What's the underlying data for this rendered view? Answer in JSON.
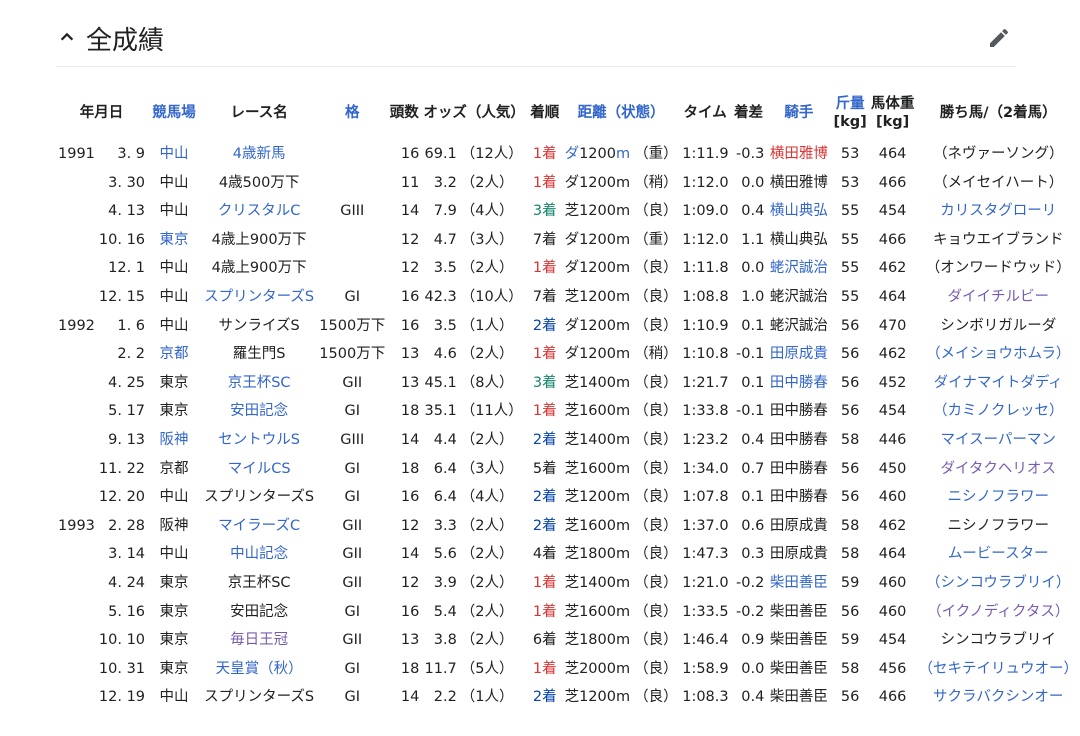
{
  "section": {
    "title": "全成績"
  },
  "headers": {
    "date": "年月日",
    "track": "競馬場",
    "race": "レース名",
    "grade": "格",
    "field": "頭数",
    "odds": "オッズ（人気）",
    "finish": "着順",
    "distance": "距離",
    "condition": "（状態）",
    "time": "タイム",
    "margin": "着差",
    "jockey": "騎手",
    "weight": "斤量",
    "weight_unit": "[kg]",
    "body": "馬体重",
    "body_unit": "[kg]",
    "winner": "勝ち馬/（2着馬）"
  },
  "rows": [
    {
      "year": "1991",
      "date": "3. 9",
      "track": "中山",
      "track_link": true,
      "race": "4歳新馬",
      "race_style": "link",
      "grade": "",
      "field": "16",
      "odds": "69.1",
      "pop": "（12人）",
      "finish": "1着",
      "finish_style": "red",
      "surface": "ダ",
      "dist": "1200",
      "dist_link": true,
      "unit": "m",
      "cond": "（重）",
      "time": "1:11.9",
      "margin": "-0.3",
      "jockey": "横田雅博",
      "jockey_style": "red",
      "weight": "53",
      "body": "464",
      "winner": "（ネヴァーソング）",
      "winner_style": ""
    },
    {
      "year": "",
      "date": "3. 30",
      "track": "中山",
      "track_link": false,
      "race": "4歳500万下",
      "race_style": "",
      "grade": "",
      "field": "11",
      "odds": "3.2",
      "pop": "（2人）",
      "finish": "1着",
      "finish_style": "red",
      "surface": "ダ",
      "dist": "1200",
      "dist_link": false,
      "unit": "m",
      "cond": "（稍）",
      "time": "1:12.0",
      "margin": "0.0",
      "jockey": "横田雅博",
      "jockey_style": "",
      "weight": "53",
      "body": "466",
      "winner": "（メイセイハート）",
      "winner_style": ""
    },
    {
      "year": "",
      "date": "4. 13",
      "track": "中山",
      "track_link": false,
      "race": "クリスタルC",
      "race_style": "link",
      "grade": "GIII",
      "field": "14",
      "odds": "7.9",
      "pop": "（4人）",
      "finish": "3着",
      "finish_style": "green",
      "surface": "芝",
      "dist": "1200",
      "dist_link": false,
      "unit": "m",
      "cond": "（良）",
      "time": "1:09.0",
      "margin": "0.4",
      "jockey": "横山典弘",
      "jockey_style": "link",
      "weight": "55",
      "body": "454",
      "winner": "カリスタグローリ",
      "winner_style": "link"
    },
    {
      "year": "",
      "date": "10. 16",
      "track": "東京",
      "track_link": true,
      "race": "4歳上900万下",
      "race_style": "",
      "grade": "",
      "field": "12",
      "odds": "4.7",
      "pop": "（3人）",
      "finish": "7着",
      "finish_style": "",
      "surface": "ダ",
      "dist": "1200",
      "dist_link": false,
      "unit": "m",
      "cond": "（重）",
      "time": "1:12.0",
      "margin": "1.1",
      "jockey": "横山典弘",
      "jockey_style": "",
      "weight": "55",
      "body": "466",
      "winner": "キョウエイブランド",
      "winner_style": ""
    },
    {
      "year": "",
      "date": "12. 1",
      "track": "中山",
      "track_link": false,
      "race": "4歳上900万下",
      "race_style": "",
      "grade": "",
      "field": "12",
      "odds": "3.5",
      "pop": "（2人）",
      "finish": "1着",
      "finish_style": "red",
      "surface": "ダ",
      "dist": "1200",
      "dist_link": false,
      "unit": "m",
      "cond": "（良）",
      "time": "1:11.8",
      "margin": "0.0",
      "jockey": "蛯沢誠治",
      "jockey_style": "link",
      "weight": "55",
      "body": "462",
      "winner": "（オンワードウッド）",
      "winner_style": ""
    },
    {
      "year": "",
      "date": "12. 15",
      "track": "中山",
      "track_link": false,
      "race": "スプリンターズS",
      "race_style": "link",
      "grade": "GI",
      "field": "16",
      "odds": "42.3",
      "pop": "（10人）",
      "finish": "7着",
      "finish_style": "",
      "surface": "芝",
      "dist": "1200",
      "dist_link": false,
      "unit": "m",
      "cond": "（良）",
      "time": "1:08.8",
      "margin": "1.0",
      "jockey": "蛯沢誠治",
      "jockey_style": "",
      "weight": "55",
      "body": "464",
      "winner": "ダイイチルビー",
      "winner_style": "visited"
    },
    {
      "year": "1992",
      "date": "1. 6",
      "track": "中山",
      "track_link": false,
      "race": "サンライズS",
      "race_style": "",
      "grade": "1500万下",
      "field": "16",
      "odds": "3.5",
      "pop": "（1人）",
      "finish": "2着",
      "finish_style": "blue",
      "surface": "ダ",
      "dist": "1200",
      "dist_link": false,
      "unit": "m",
      "cond": "（良）",
      "time": "1:10.9",
      "margin": "0.1",
      "jockey": "蛯沢誠治",
      "jockey_style": "",
      "weight": "56",
      "body": "470",
      "winner": "シンボリガルーダ",
      "winner_style": ""
    },
    {
      "year": "",
      "date": "2. 2",
      "track": "京都",
      "track_link": true,
      "race": "羅生門S",
      "race_style": "",
      "grade": "1500万下",
      "field": "13",
      "odds": "4.6",
      "pop": "（2人）",
      "finish": "1着",
      "finish_style": "red",
      "surface": "ダ",
      "dist": "1200",
      "dist_link": false,
      "unit": "m",
      "cond": "（稍）",
      "time": "1:10.8",
      "margin": "-0.1",
      "jockey": "田原成貴",
      "jockey_style": "link",
      "weight": "56",
      "body": "462",
      "winner": "（メイショウホムラ）",
      "winner_style": "link"
    },
    {
      "year": "",
      "date": "4. 25",
      "track": "東京",
      "track_link": false,
      "race": "京王杯SC",
      "race_style": "link",
      "grade": "GII",
      "field": "13",
      "odds": "45.1",
      "pop": "（8人）",
      "finish": "3着",
      "finish_style": "green",
      "surface": "芝",
      "dist": "1400",
      "dist_link": false,
      "unit": "m",
      "cond": "（良）",
      "time": "1:21.7",
      "margin": "0.1",
      "jockey": "田中勝春",
      "jockey_style": "link",
      "weight": "56",
      "body": "452",
      "winner": "ダイナマイトダディ",
      "winner_style": "link"
    },
    {
      "year": "",
      "date": "5. 17",
      "track": "東京",
      "track_link": false,
      "race": "安田記念",
      "race_style": "link",
      "grade": "GI",
      "field": "18",
      "odds": "35.1",
      "pop": "（11人）",
      "finish": "1着",
      "finish_style": "red",
      "surface": "芝",
      "dist": "1600",
      "dist_link": false,
      "unit": "m",
      "cond": "（良）",
      "time": "1:33.8",
      "margin": "-0.1",
      "jockey": "田中勝春",
      "jockey_style": "",
      "weight": "56",
      "body": "454",
      "winner": "（カミノクレッセ）",
      "winner_style": "link"
    },
    {
      "year": "",
      "date": "9. 13",
      "track": "阪神",
      "track_link": true,
      "race": "セントウルS",
      "race_style": "link",
      "grade": "GIII",
      "field": "14",
      "odds": "4.4",
      "pop": "（2人）",
      "finish": "2着",
      "finish_style": "blue",
      "surface": "芝",
      "dist": "1400",
      "dist_link": false,
      "unit": "m",
      "cond": "（良）",
      "time": "1:23.2",
      "margin": "0.4",
      "jockey": "田中勝春",
      "jockey_style": "",
      "weight": "58",
      "body": "446",
      "winner": "マイスーパーマン",
      "winner_style": "link"
    },
    {
      "year": "",
      "date": "11. 22",
      "track": "京都",
      "track_link": false,
      "race": "マイルCS",
      "race_style": "link",
      "grade": "GI",
      "field": "18",
      "odds": "6.4",
      "pop": "（3人）",
      "finish": "5着",
      "finish_style": "",
      "surface": "芝",
      "dist": "1600",
      "dist_link": false,
      "unit": "m",
      "cond": "（良）",
      "time": "1:34.0",
      "margin": "0.7",
      "jockey": "田中勝春",
      "jockey_style": "",
      "weight": "56",
      "body": "450",
      "winner": "ダイタクヘリオス",
      "winner_style": "visited"
    },
    {
      "year": "",
      "date": "12. 20",
      "track": "中山",
      "track_link": false,
      "race": "スプリンターズS",
      "race_style": "",
      "grade": "GI",
      "field": "16",
      "odds": "6.4",
      "pop": "（4人）",
      "finish": "2着",
      "finish_style": "blue",
      "surface": "芝",
      "dist": "1200",
      "dist_link": false,
      "unit": "m",
      "cond": "（良）",
      "time": "1:07.8",
      "margin": "0.1",
      "jockey": "田中勝春",
      "jockey_style": "",
      "weight": "56",
      "body": "460",
      "winner": "ニシノフラワー",
      "winner_style": "link"
    },
    {
      "year": "1993",
      "date": "2. 28",
      "track": "阪神",
      "track_link": false,
      "race": "マイラーズC",
      "race_style": "link",
      "grade": "GII",
      "field": "12",
      "odds": "3.3",
      "pop": "（2人）",
      "finish": "2着",
      "finish_style": "blue",
      "surface": "芝",
      "dist": "1600",
      "dist_link": false,
      "unit": "m",
      "cond": "（良）",
      "time": "1:37.0",
      "margin": "0.6",
      "jockey": "田原成貴",
      "jockey_style": "",
      "weight": "58",
      "body": "462",
      "winner": "ニシノフラワー",
      "winner_style": ""
    },
    {
      "year": "",
      "date": "3. 14",
      "track": "中山",
      "track_link": false,
      "race": "中山記念",
      "race_style": "link",
      "grade": "GII",
      "field": "14",
      "odds": "5.6",
      "pop": "（2人）",
      "finish": "4着",
      "finish_style": "",
      "surface": "芝",
      "dist": "1800",
      "dist_link": false,
      "unit": "m",
      "cond": "（良）",
      "time": "1:47.3",
      "margin": "0.3",
      "jockey": "田原成貴",
      "jockey_style": "",
      "weight": "58",
      "body": "464",
      "winner": "ムービースター",
      "winner_style": "link"
    },
    {
      "year": "",
      "date": "4. 24",
      "track": "東京",
      "track_link": false,
      "race": "京王杯SC",
      "race_style": "",
      "grade": "GII",
      "field": "12",
      "odds": "3.9",
      "pop": "（2人）",
      "finish": "1着",
      "finish_style": "red",
      "surface": "芝",
      "dist": "1400",
      "dist_link": false,
      "unit": "m",
      "cond": "（良）",
      "time": "1:21.0",
      "margin": "-0.2",
      "jockey": "柴田善臣",
      "jockey_style": "link",
      "weight": "59",
      "body": "460",
      "winner": "（シンコウラブリイ）",
      "winner_style": "link"
    },
    {
      "year": "",
      "date": "5. 16",
      "track": "東京",
      "track_link": false,
      "race": "安田記念",
      "race_style": "",
      "grade": "GI",
      "field": "16",
      "odds": "5.4",
      "pop": "（2人）",
      "finish": "1着",
      "finish_style": "red",
      "surface": "芝",
      "dist": "1600",
      "dist_link": false,
      "unit": "m",
      "cond": "（良）",
      "time": "1:33.5",
      "margin": "-0.2",
      "jockey": "柴田善臣",
      "jockey_style": "",
      "weight": "56",
      "body": "460",
      "winner": "（イクノディクタス）",
      "winner_style": "visited"
    },
    {
      "year": "",
      "date": "10. 10",
      "track": "東京",
      "track_link": false,
      "race": "毎日王冠",
      "race_style": "visited",
      "grade": "GII",
      "field": "13",
      "odds": "3.8",
      "pop": "（2人）",
      "finish": "6着",
      "finish_style": "",
      "surface": "芝",
      "dist": "1800",
      "dist_link": false,
      "unit": "m",
      "cond": "（良）",
      "time": "1:46.4",
      "margin": "0.9",
      "jockey": "柴田善臣",
      "jockey_style": "",
      "weight": "59",
      "body": "454",
      "winner": "シンコウラブリイ",
      "winner_style": ""
    },
    {
      "year": "",
      "date": "10. 31",
      "track": "東京",
      "track_link": false,
      "race": "天皇賞（秋）",
      "race_style": "link",
      "grade": "GI",
      "field": "18",
      "odds": "11.7",
      "pop": "（5人）",
      "finish": "1着",
      "finish_style": "red",
      "surface": "芝",
      "dist": "2000",
      "dist_link": false,
      "unit": "m",
      "cond": "（良）",
      "time": "1:58.9",
      "margin": "0.0",
      "jockey": "柴田善臣",
      "jockey_style": "",
      "weight": "58",
      "body": "456",
      "winner": "（セキテイリュウオー）",
      "winner_style": "link"
    },
    {
      "year": "",
      "date": "12. 19",
      "track": "中山",
      "track_link": false,
      "race": "スプリンターズS",
      "race_style": "",
      "grade": "GI",
      "field": "14",
      "odds": "2.2",
      "pop": "（1人）",
      "finish": "2着",
      "finish_style": "blue",
      "surface": "芝",
      "dist": "1200",
      "dist_link": false,
      "unit": "m",
      "cond": "（良）",
      "time": "1:08.3",
      "margin": "0.4",
      "jockey": "柴田善臣",
      "jockey_style": "",
      "weight": "56",
      "body": "466",
      "winner": "サクラバクシンオー",
      "winner_style": "link"
    }
  ]
}
